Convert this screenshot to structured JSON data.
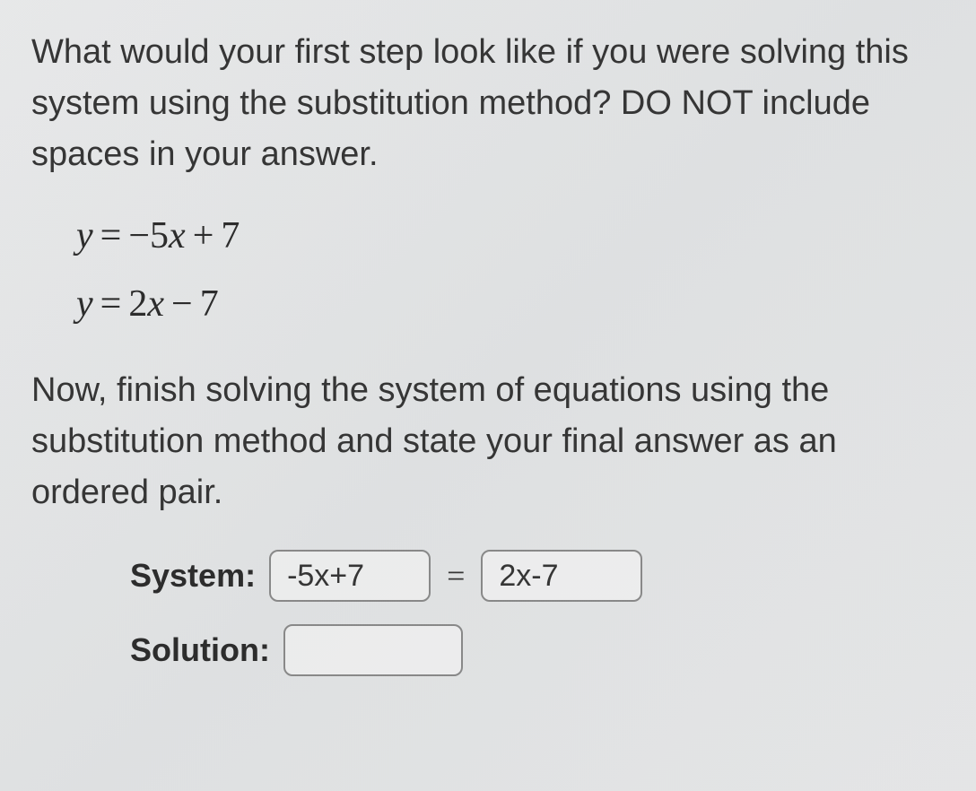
{
  "question": {
    "part1": "What would your first step look like if you were solving this system using the substitution method? DO NOT include spaces in your answer.",
    "equation1_lhs": "y",
    "equation1_rhs_coef": "−5",
    "equation1_rhs_var": "x",
    "equation1_rhs_op": "+",
    "equation1_rhs_const": "7",
    "equation2_lhs": "y",
    "equation2_rhs_coef": "2",
    "equation2_rhs_var": "x",
    "equation2_rhs_op": "−",
    "equation2_rhs_const": "7",
    "part2": "Now, finish solving the system of equations using the substitution method and state your final answer as an ordered pair."
  },
  "answers": {
    "system_label": "System:",
    "system_input1": "-5x+7",
    "equals": "=",
    "system_input2": "2x-7",
    "solution_label": "Solution:",
    "solution_input": ""
  }
}
